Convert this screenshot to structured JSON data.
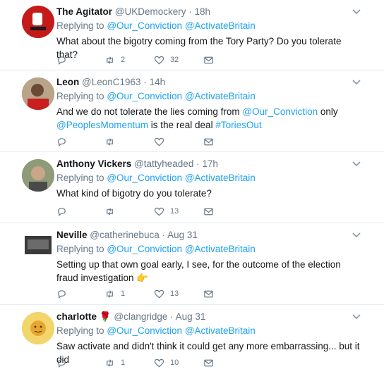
{
  "tweets": [
    {
      "name": "The Agitator",
      "handle": "@UKDemockery",
      "time": "18h",
      "replying_prefix": "Replying to",
      "reply_to": [
        "@Our_Conviction",
        "@ActivateBritain"
      ],
      "text": "What about the bigotry coming from the Tory Party? Do you tolerate that?",
      "retweets": "2",
      "likes": "32",
      "avatar_color": "#c41a1a"
    },
    {
      "name": "Leon",
      "handle": "@LeonC1963",
      "time": "14h",
      "replying_prefix": "Replying to",
      "reply_to": [
        "@Our_Conviction",
        "@ActivateBritain"
      ],
      "text_parts": [
        "And we do not tolerate the lies coming from ",
        "@Our_Conviction",
        " only ",
        "@PeoplesMomentum",
        " is the real deal ",
        "#ToriesOut"
      ],
      "retweets": "",
      "likes": "",
      "avatar_color": "#8a5a3a"
    },
    {
      "name": "Anthony Vickers",
      "handle": "@tattyheaded",
      "time": "17h",
      "replying_prefix": "Replying to",
      "reply_to": [
        "@Our_Conviction",
        "@ActivateBritain"
      ],
      "text": "What kind of bigotry do you tolerate?",
      "retweets": "",
      "likes": "13",
      "avatar_color": "#7d8a6a"
    },
    {
      "name": "Neville",
      "handle": "@catherinebuca",
      "time": "Aug 31",
      "replying_prefix": "Replying to",
      "reply_to": [
        "@Our_Conviction",
        "@ActivateBritain"
      ],
      "text": "Setting up that own goal early, I see, for the outcome of the election fraud investigation",
      "emoji": "👉",
      "retweets": "1",
      "likes": "13",
      "avatar_color": "#555555"
    },
    {
      "name": "charlotte",
      "name_emoji": "🌹",
      "handle": "@clangridge",
      "time": "Aug 31",
      "replying_prefix": "Replying to",
      "reply_to": [
        "@Our_Conviction",
        "@ActivateBritain"
      ],
      "text": "Saw activate and didn't think it could get any more embarrassing... but it did",
      "retweets": "1",
      "likes": "10",
      "avatar_color": "#e8c64a"
    }
  ],
  "colors": {
    "link": "#1da1f2",
    "secondary": "#657786",
    "border": "#e6ecf0"
  }
}
